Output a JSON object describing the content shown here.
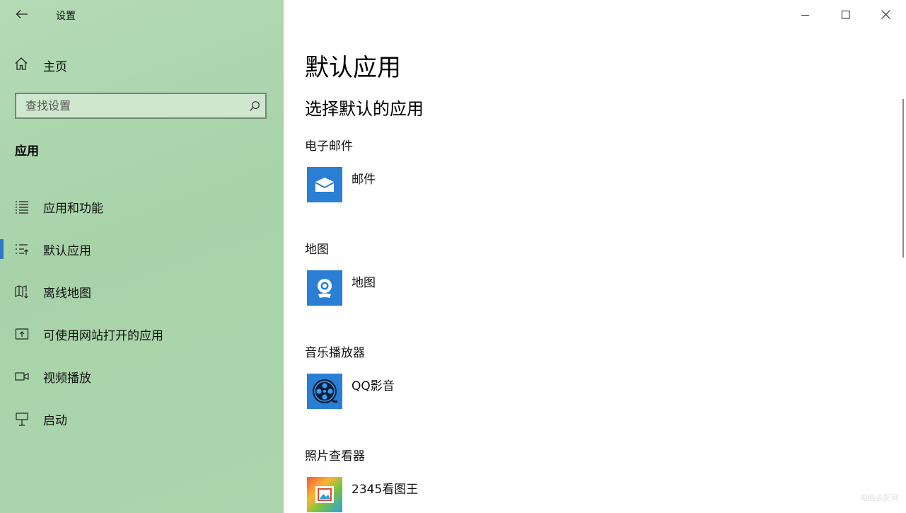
{
  "window": {
    "title": "设置",
    "controls": {
      "minimize": "minimize-icon",
      "maximize": "maximize-icon",
      "close": "close-icon"
    }
  },
  "sidebar": {
    "home_label": "主页",
    "search_placeholder": "查找设置",
    "section_heading": "应用",
    "items": [
      {
        "label": "应用和功能",
        "icon": "list-icon"
      },
      {
        "label": "默认应用",
        "icon": "default-apps-icon",
        "selected": true
      },
      {
        "label": "离线地图",
        "icon": "offline-map-icon"
      },
      {
        "label": "可使用网站打开的应用",
        "icon": "open-in-app-icon"
      },
      {
        "label": "视频播放",
        "icon": "video-icon"
      },
      {
        "label": "启动",
        "icon": "startup-icon"
      }
    ],
    "accent_color": "#2e78c8"
  },
  "main": {
    "title": "默认应用",
    "subtitle": "选择默认的应用",
    "categories": [
      {
        "label": "电子邮件",
        "app": "邮件",
        "icon": "mail-app-icon"
      },
      {
        "label": "地图",
        "app": "地图",
        "icon": "maps-app-icon"
      },
      {
        "label": "音乐播放器",
        "app": "QQ影音",
        "icon": "qq-player-app-icon"
      },
      {
        "label": "照片查看器",
        "app": "2345看图王",
        "icon": "photo-viewer-app-icon"
      }
    ]
  },
  "watermark": "电脑装配网"
}
